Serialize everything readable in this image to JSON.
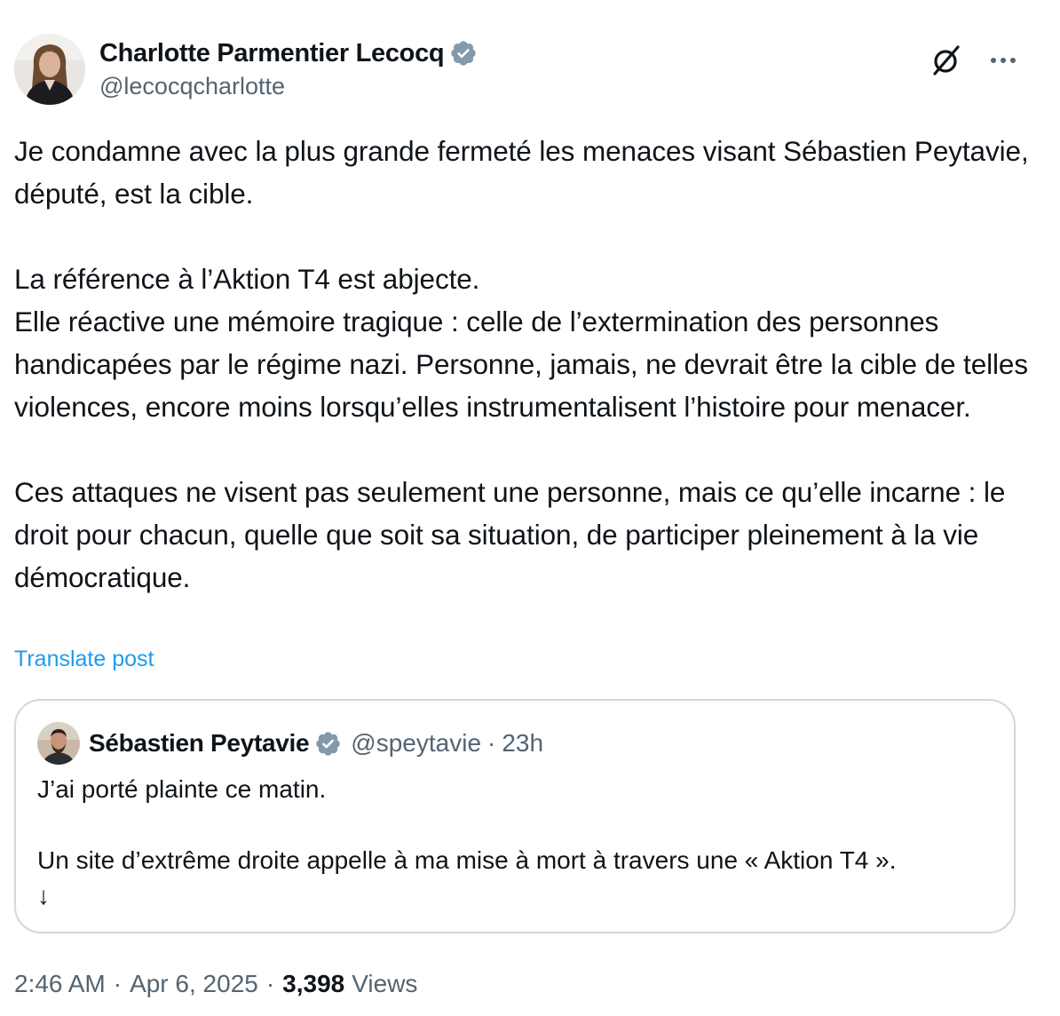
{
  "author": {
    "display_name": "Charlotte Parmentier Lecocq",
    "handle": "@lecocqcharlotte",
    "verified_icon": "verified-badge",
    "verified_color": "#829aab"
  },
  "header_actions": {
    "grok_icon": "grok-icon",
    "more_icon": "more-horizontal-icon"
  },
  "post": {
    "text": "Je condamne avec la plus grande fermeté les menaces visant Sébastien Peytavie, député, est la cible.\n\nLa référence à l’Aktion T4 est abjecte.\nElle réactive une mémoire tragique : celle de l’extermination des personnes handicapées par le régime nazi. Personne, jamais, ne devrait être la cible de telles violences, encore moins lorsqu’elles instrumentalisent l’histoire pour menacer.\n\nCes attaques ne visent pas seulement une personne, mais ce qu’elle incarne : le droit pour chacun, quelle que soit sa situation, de participer pleinement à la vie démocratique.",
    "translate_label": "Translate post"
  },
  "quote": {
    "display_name": "Sébastien Peytavie",
    "handle": "@speytavie",
    "separator": "·",
    "time": "23h",
    "text": "J’ai porté plainte ce matin.\n\nUn site d’extrême droite appelle à ma mise à mort à travers une « Aktion T4 ».\n↓"
  },
  "meta": {
    "time": "2:46 AM",
    "separator": "·",
    "date": "Apr 6, 2025",
    "views_count": "3,398",
    "views_label": "Views"
  },
  "colors": {
    "text_primary": "#0f1419",
    "text_secondary": "#536471",
    "link": "#1d9bf0",
    "border": "#cfd9de",
    "verified": "#829aab"
  }
}
